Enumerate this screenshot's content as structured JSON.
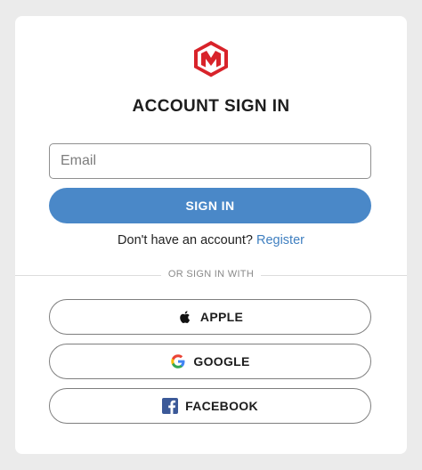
{
  "brand": {
    "logo_icon": "red-cube-m-logo-icon",
    "logo_color": "#d8232a"
  },
  "header": {
    "title": "ACCOUNT SIGN IN"
  },
  "form": {
    "email_placeholder": "Email",
    "email_value": "",
    "signin_label": "SIGN IN",
    "signin_color": "#4a88c8"
  },
  "register": {
    "prompt": "Don't have an account?",
    "link_label": "Register"
  },
  "divider": {
    "label": "OR SIGN IN WITH"
  },
  "social": {
    "apple_label": "APPLE",
    "apple_icon": "apple-icon",
    "google_label": "GOOGLE",
    "google_icon": "google-icon",
    "facebook_label": "FACEBOOK",
    "facebook_icon": "facebook-icon"
  }
}
